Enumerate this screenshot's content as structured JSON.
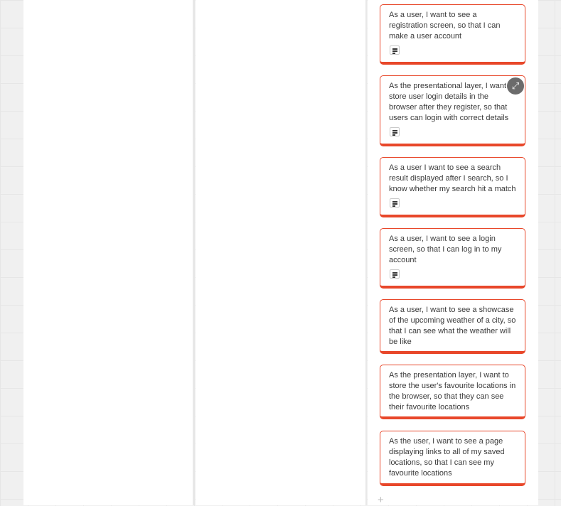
{
  "board": {
    "columns": [
      {
        "name": ""
      },
      {
        "name": ""
      },
      {
        "name": "",
        "cards": [
          {
            "text": "As a user, I want to see a registration screen, so that I can make a user account",
            "has_description": true,
            "description_icon": "notes-icon"
          },
          {
            "text": "As the presentational layer, I want to store user login details in the browser after they register, so that users can login with correct details",
            "has_description": true,
            "description_icon": "notes-icon"
          },
          {
            "text": "As a user I want to see a search result displayed after I search, so I know whether my search hit a match",
            "has_description": true,
            "description_icon": "notes-icon"
          },
          {
            "text": "As a user, I want to see a login screen, so that I can log in to my account",
            "has_description": true,
            "description_icon": "notes-icon"
          },
          {
            "text": "As a user, I want to see a showcase of the upcoming weather of a city, so that I can see what the weather will be like",
            "has_description": false
          },
          {
            "text": "As the presentation layer, I want to store the user's favourite locations in the browser, so that they can see their favourite locations",
            "has_description": false
          },
          {
            "text": "As the user, I want to see a page displaying links to all of my saved locations, so that I can see my favourite locations",
            "has_description": false
          }
        ]
      }
    ],
    "card_expand_icon": "expand-arrows-icon",
    "add_icon": "plus-icon",
    "add_label": "+"
  },
  "colors": {
    "card_border": "#e8472a",
    "background_grid": "#f0f0f0",
    "column_bg": "#ffffff"
  }
}
